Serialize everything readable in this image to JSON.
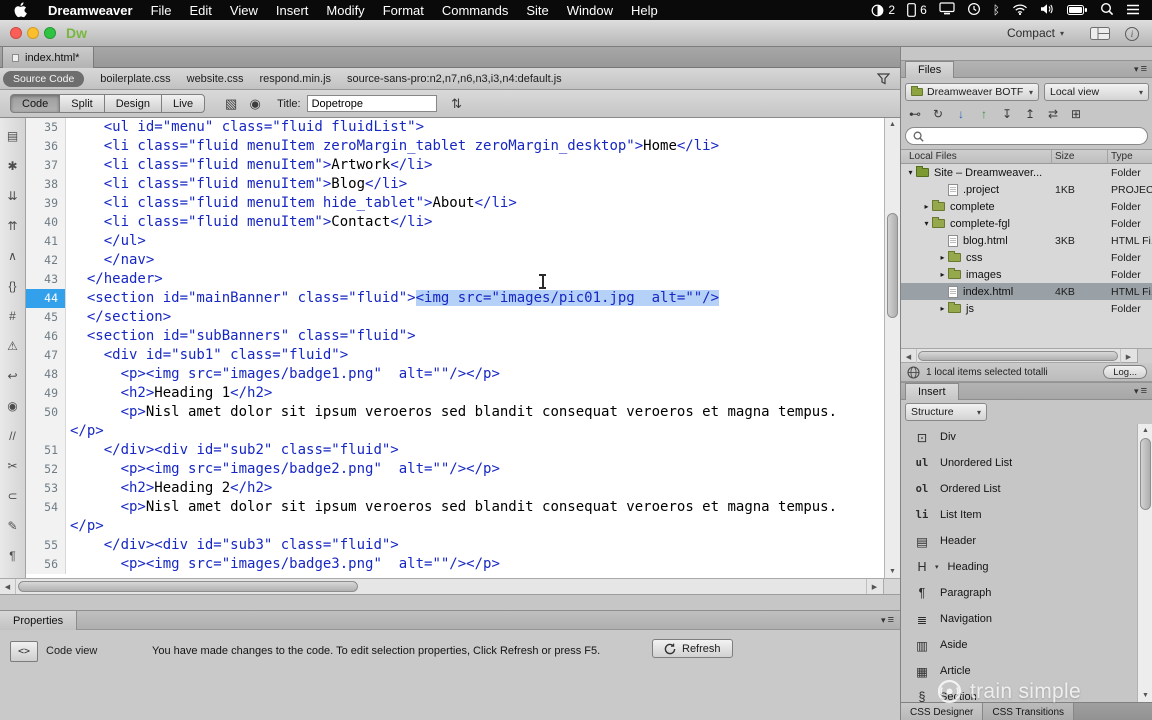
{
  "menubar": {
    "app_name": "Dreamweaver",
    "menus": [
      "File",
      "Edit",
      "View",
      "Insert",
      "Modify",
      "Format",
      "Commands",
      "Site",
      "Window",
      "Help"
    ],
    "status_numbers": {
      "first": "2",
      "second": "6"
    }
  },
  "titlebar": {
    "app_logo": "Dw",
    "workspace_label": "Compact"
  },
  "doc_tab": "index.html*",
  "related_bar": {
    "source_code_label": "Source Code",
    "files": [
      "boilerplate.css",
      "website.css",
      "respond.min.js",
      "source-sans-pro:n2,n7,n6,n3,i3,n4:default.js"
    ]
  },
  "toolbar": {
    "views": [
      "Code",
      "Split",
      "Design",
      "Live"
    ],
    "active_view": "Code",
    "title_label": "Title:",
    "title_value": "Dopetrope"
  },
  "code_toolbar": [
    {
      "name": "open-documents-icon",
      "glyph": "▤"
    },
    {
      "name": "collapse-full-tag-icon",
      "glyph": "✱"
    },
    {
      "name": "collapse-selection-icon",
      "glyph": "⇊"
    },
    {
      "name": "expand-all-icon",
      "glyph": "⇈"
    },
    {
      "name": "select-parent-tag-icon",
      "glyph": "∧"
    },
    {
      "name": "balance-braces-icon",
      "glyph": "{}"
    },
    {
      "name": "line-numbers-icon",
      "glyph": "#"
    },
    {
      "name": "highlight-invalid-code-icon",
      "glyph": "⚠"
    },
    {
      "name": "word-wrap-icon",
      "glyph": "↩"
    },
    {
      "name": "syntax-error-alerts-icon",
      "glyph": "◉"
    },
    {
      "name": "apply-comment-icon",
      "glyph": "//"
    },
    {
      "name": "remove-comment-icon",
      "glyph": "✂"
    },
    {
      "name": "wrap-tag-icon",
      "glyph": "⊂"
    },
    {
      "name": "recent-snippets-icon",
      "glyph": "✎"
    },
    {
      "name": "format-source-code-icon",
      "glyph": "¶"
    }
  ],
  "code": {
    "lines": [
      {
        "num": "35",
        "text": "    <ul id=\"menu\" class=\"fluid fluidList\">"
      },
      {
        "num": "36",
        "text": "    <li class=\"fluid menuItem zeroMargin_tablet zeroMargin_desktop\">Home</li>"
      },
      {
        "num": "37",
        "text": "    <li class=\"fluid menuItem\">Artwork</li>"
      },
      {
        "num": "38",
        "text": "    <li class=\"fluid menuItem\">Blog</li>"
      },
      {
        "num": "39",
        "text": "    <li class=\"fluid menuItem hide_tablet\">About</li>"
      },
      {
        "num": "40",
        "text": "    <li class=\"fluid menuItem\">Contact</li>"
      },
      {
        "num": "41",
        "text": "    </ul>"
      },
      {
        "num": "42",
        "text": "    </nav>"
      },
      {
        "num": "43",
        "text": "  </header>"
      },
      {
        "num": "44",
        "text": "  <section id=\"mainBanner\" class=\"fluid\">",
        "sel": "<img src=\"images/pic01.jpg  alt=\"\"/>",
        "active": true
      },
      {
        "num": "45",
        "text": "  </section>"
      },
      {
        "num": "46",
        "text": "  <section id=\"subBanners\" class=\"fluid\">"
      },
      {
        "num": "47",
        "text": "    <div id=\"sub1\" class=\"fluid\">"
      },
      {
        "num": "48",
        "text": "      <p><img src=\"images/badge1.png\"  alt=\"\"/></p>"
      },
      {
        "num": "49",
        "text": "      <h2>Heading 1</h2>"
      },
      {
        "num": "50",
        "text": "      <p>Nisl amet dolor sit ipsum veroeros sed blandit consequat veroeros et magna tempus."
      },
      {
        "num": "",
        "text": "</p>"
      },
      {
        "num": "51",
        "text": "    </div><div id=\"sub2\" class=\"fluid\">"
      },
      {
        "num": "52",
        "text": "      <p><img src=\"images/badge2.png\"  alt=\"\"/></p>"
      },
      {
        "num": "53",
        "text": "      <h2>Heading 2</h2>"
      },
      {
        "num": "54",
        "text": "      <p>Nisl amet dolor sit ipsum veroeros sed blandit consequat veroeros et magna tempus."
      },
      {
        "num": "",
        "text": "</p>"
      },
      {
        "num": "55",
        "text": "    </div><div id=\"sub3\" class=\"fluid\">"
      },
      {
        "num": "56",
        "text": "      <p><img src=\"images/badge3.png\"  alt=\"\"/></p>"
      }
    ]
  },
  "files_panel": {
    "tab": "Files",
    "site_dropdown": "Dreamweaver BOTF",
    "view_dropdown": "Local view",
    "toolbar_icons": [
      {
        "name": "connect-icon",
        "glyph": "⊷"
      },
      {
        "name": "refresh-icon",
        "glyph": "↻"
      },
      {
        "name": "get-files-icon",
        "glyph": "↓",
        "color": "#2a62c5"
      },
      {
        "name": "put-files-icon",
        "glyph": "↑",
        "color": "#3f8f3f"
      },
      {
        "name": "check-out-icon",
        "glyph": "↧"
      },
      {
        "name": "check-in-icon",
        "glyph": "↥"
      },
      {
        "name": "synchronize-icon",
        "glyph": "⇄"
      },
      {
        "name": "expand-panel-icon",
        "glyph": "⊞"
      }
    ],
    "columns": [
      "Local Files",
      "Size",
      "Type"
    ],
    "tree": [
      {
        "icon": "folder-root",
        "indent": 0,
        "arrow": "down",
        "name": "Site – Dreamweaver...",
        "size": "",
        "type": "Folder"
      },
      {
        "icon": "file",
        "indent": 2,
        "arrow": "",
        "name": ".project",
        "size": "1KB",
        "type": "PROJECT"
      },
      {
        "icon": "folder",
        "indent": 1,
        "arrow": "right",
        "name": "complete",
        "size": "",
        "type": "Folder"
      },
      {
        "icon": "folder",
        "indent": 1,
        "arrow": "down",
        "name": "complete-fgl",
        "size": "",
        "type": "Folder"
      },
      {
        "icon": "file",
        "indent": 2,
        "arrow": "",
        "name": "blog.html",
        "size": "3KB",
        "type": "HTML Fi..."
      },
      {
        "icon": "folder",
        "indent": 2,
        "arrow": "right",
        "name": "css",
        "size": "",
        "type": "Folder"
      },
      {
        "icon": "folder",
        "indent": 2,
        "arrow": "right",
        "name": "images",
        "size": "",
        "type": "Folder"
      },
      {
        "icon": "file",
        "indent": 2,
        "arrow": "",
        "name": "index.html",
        "size": "4KB",
        "type": "HTML Fi...",
        "selected": true
      },
      {
        "icon": "folder",
        "indent": 2,
        "arrow": "right",
        "name": "js",
        "size": "",
        "type": "Folder"
      }
    ],
    "status_text": "1 local items selected totalli",
    "log_button": "Log..."
  },
  "insert_panel": {
    "tab": "Insert",
    "category": "Structure",
    "items": [
      {
        "label": "Div",
        "icon": "div-icon",
        "glyph": "⊡"
      },
      {
        "label": "Unordered List",
        "icon": "unordered-list-icon",
        "glyph": "ul",
        "mono": true
      },
      {
        "label": "Ordered List",
        "icon": "ordered-list-icon",
        "glyph": "ol",
        "mono": true
      },
      {
        "label": "List Item",
        "icon": "list-item-icon",
        "glyph": "li",
        "mono": true
      },
      {
        "label": "Header",
        "icon": "header-icon",
        "glyph": "▤"
      },
      {
        "label": "Heading",
        "icon": "heading-icon",
        "glyph": "H",
        "dropdown": true
      },
      {
        "label": "Paragraph",
        "icon": "paragraph-icon",
        "glyph": "¶"
      },
      {
        "label": "Navigation",
        "icon": "navigation-icon",
        "glyph": "≣"
      },
      {
        "label": "Aside",
        "icon": "aside-icon",
        "glyph": "▥"
      },
      {
        "label": "Article",
        "icon": "article-icon",
        "glyph": "▦"
      },
      {
        "label": "Section",
        "icon": "section-icon",
        "glyph": "§"
      }
    ]
  },
  "bottom_tabs": [
    "CSS Designer",
    "CSS Transitions"
  ],
  "properties_panel": {
    "tab": "Properties",
    "mode_label": "Code view",
    "message": "You have made changes to the code. To edit selection properties, Click Refresh or press F5.",
    "refresh_label": "Refresh"
  },
  "watermark": "train simple"
}
